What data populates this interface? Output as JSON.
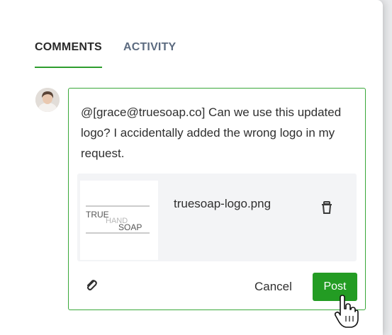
{
  "tabs": [
    {
      "label": "COMMENTS",
      "active": true
    },
    {
      "label": "ACTIVITY",
      "active": false
    }
  ],
  "comment": {
    "text": "@[grace@truesoap.co] Can we use this updated logo? I accidentally added the wrong logo in my request."
  },
  "attachment": {
    "file_name": "truesoap-logo.png",
    "logo_text": {
      "top": "TRUE",
      "middle": "HAND",
      "bottom": "SOAP"
    }
  },
  "actions": {
    "cancel_label": "Cancel",
    "post_label": "Post"
  },
  "colors": {
    "accent_green": "#239c23",
    "border_green": "#39a839",
    "tab_underline": "#2e9e2e",
    "inactive_tab": "#5c6b80"
  },
  "icons": {
    "attach": "paperclip-icon",
    "delete": "trash-icon",
    "cursor": "hand-pointer-cursor"
  }
}
